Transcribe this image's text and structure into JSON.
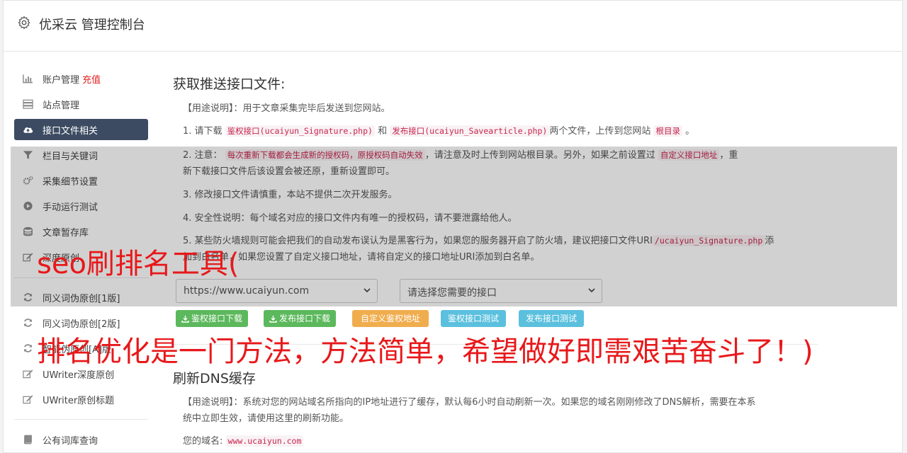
{
  "header": {
    "title": "优采云 管理控制台"
  },
  "sidebar": {
    "items": [
      {
        "label": "账户管理",
        "extra": "充值",
        "icon": "bar-chart-icon"
      },
      {
        "label": "站点管理",
        "icon": "server-icon"
      },
      {
        "label": "接口文件相关",
        "icon": "cloud-upload-icon",
        "active": true
      },
      {
        "label": "栏目与关键词",
        "icon": "filter-icon"
      },
      {
        "label": "采集细节设置",
        "icon": "cogs-icon"
      },
      {
        "label": "手动运行测试",
        "icon": "play-circle-icon"
      },
      {
        "label": "文章暂存库",
        "icon": "database-icon"
      },
      {
        "label": "深度原创",
        "icon": "edit-icon"
      },
      {
        "label": "同义词伪原创[1版]",
        "icon": "refresh-icon"
      },
      {
        "label": "同义词伪原创[2版]",
        "icon": "refresh-icon"
      },
      {
        "label": "智能伪原创[A]版",
        "icon": "refresh-icon"
      },
      {
        "label": "UWriter深度原创",
        "icon": "edit-icon"
      },
      {
        "label": "UWriter原创标题",
        "icon": "edit-icon"
      },
      {
        "label": "公有词库查询",
        "icon": "book-icon"
      }
    ]
  },
  "section1": {
    "title": "获取推送接口文件:",
    "usage_label": "【用途说明】",
    "usage_text": "：用于文章采集完毕后发送到您网站。",
    "step1_a": "1. 请下载",
    "step1_code1": "鉴权接口(ucaiyun_Signature.php)",
    "step1_b": "和",
    "step1_code2": "发布接口(ucaiyun_Savearticle.php)",
    "step1_c": "两个文件，上传到您网站",
    "step1_code3": "根目录",
    "step1_d": "。",
    "step2_a": "2. 注意：",
    "step2_code1": "每次重新下载都会生成新的授权码，原授权码自动失效",
    "step2_b": "，请注意及时上传到网站根目录。另外，如果之前设置过",
    "step2_code2": "自定义接口地址",
    "step2_c": "，重",
    "step2_line2": "新下载接口文件后该设置会被还原，重新设置即可。",
    "step3": "3. 修改接口文件请慎重，本站不提供二次开发服务。",
    "step4": "4. 安全性说明：每个域名对应的接口文件内有唯一的授权码，请不要泄露给他人。",
    "step5_a": "5. 某些防火墙规则可能会把我们的自动发布误认为是黑客行为，如果您的服务器开启了防火墙，建议把接口文件URI",
    "step5_code": "/ucaiyun_Signature.php",
    "step5_b": "添",
    "step5_line2": "加到白名单，如果您设置了自定义接口地址，请将自定义的接口地址URI添加到白名单。",
    "domain_select": "https://www.ucaiyun.com",
    "interface_select": "请选择您需要的接口",
    "buttons": {
      "download_sign": "鉴权接口下载",
      "download_publish": "发布接口下载",
      "custom_sign": "自定义鉴权地址",
      "test_sign": "鉴权接口测试",
      "test_publish": "发布接口测试"
    }
  },
  "section2": {
    "title": "刷新DNS缓存",
    "usage_label": "【用途说明】",
    "usage_text": "：系统对您的网站域名所指向的IP地址进行了缓存，默认每6小时自动刷新一次。如果您的域名刚刚修改了DNS解析，需要在本系",
    "usage_line2": "统中立即生效，请使用这里的刷新功能。",
    "domain_label": "您的域名:",
    "domain_value": "www.ucaiyun.com"
  },
  "watermark": {
    "line1": "seo刷排名工具(",
    "line2": "排名优化是一门方法，方法简单，希望做好即需艰苦奋斗了！)"
  },
  "colors": {
    "accent_dark": "#3c4b62",
    "red": "#e0201f",
    "green": "#5cb85c",
    "orange": "#f0ad4e",
    "blue": "#5bc0de"
  }
}
